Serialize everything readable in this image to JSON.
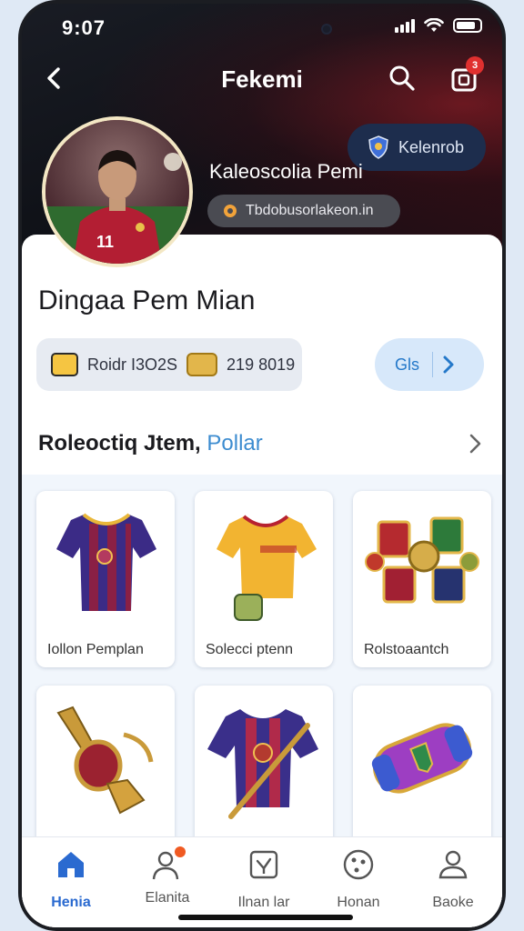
{
  "status": {
    "time": "9:07"
  },
  "header": {
    "title": "Fekemi",
    "cart_count": "3"
  },
  "profile": {
    "badge_label": "Kelenrob",
    "collector_name": "Kaleoscolia Pemi",
    "url": "Tbdobusorlakeon.in",
    "name": "Dingaa Pem Mian",
    "stats_a": "Roidr I3O2S",
    "stats_b": "219 8019",
    "action_label": "Gls"
  },
  "section": {
    "title": "Roleoctiq Jtem,",
    "link": "Pollar"
  },
  "items": [
    {
      "label": "Iollon Pemplan"
    },
    {
      "label": "Solecci ptenn"
    },
    {
      "label": "Rolstoaantch"
    },
    {
      "label": ""
    },
    {
      "label": ""
    },
    {
      "label": ""
    }
  ],
  "tabs": [
    {
      "label": "Henia",
      "icon": "home-icon",
      "active": true
    },
    {
      "label": "Elanita",
      "icon": "profile-icon",
      "active": false
    },
    {
      "label": "Ilnan lar",
      "icon": "collection-icon",
      "active": false
    },
    {
      "label": "Honan",
      "icon": "ball-icon",
      "active": false
    },
    {
      "label": "Baoke",
      "icon": "user-icon",
      "active": false
    }
  ],
  "colors": {
    "accent": "#2a6ad0",
    "badge": "#e0302f",
    "notify_dot": "#f05a22"
  }
}
